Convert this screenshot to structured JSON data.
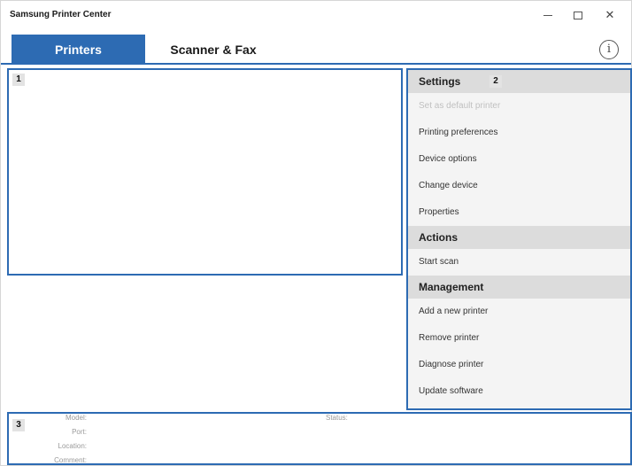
{
  "window": {
    "title": "Samsung Printer Center"
  },
  "tabs": [
    {
      "label": "Printers",
      "active": true
    },
    {
      "label": "Scanner & Fax",
      "active": false
    }
  ],
  "info_icon": "info-circle-icon",
  "panels": {
    "list_number": "1",
    "sidebar_number": "2",
    "details_number": "3"
  },
  "sidebar": {
    "sections": [
      {
        "title": "Settings",
        "items": [
          {
            "label": "Set as default printer",
            "enabled": false
          },
          {
            "label": "Printing preferences",
            "enabled": true
          },
          {
            "label": "Device options",
            "enabled": true
          },
          {
            "label": "Change device",
            "enabled": true
          },
          {
            "label": "Properties",
            "enabled": true
          }
        ]
      },
      {
        "title": "Actions",
        "items": [
          {
            "label": "Start scan",
            "enabled": true
          }
        ]
      },
      {
        "title": "Management",
        "items": [
          {
            "label": "Add a new printer",
            "enabled": true
          },
          {
            "label": "Remove printer",
            "enabled": true
          },
          {
            "label": "Diagnose printer",
            "enabled": true
          },
          {
            "label": "Update software",
            "enabled": true
          }
        ]
      }
    ]
  },
  "details": {
    "model_label": "Model:",
    "port_label": "Port:",
    "location_label": "Location:",
    "comment_label": "Comment:",
    "status_label": "Status:"
  },
  "colors": {
    "accent": "#2d6bb3",
    "section_bg": "#dcdcdc",
    "disabled_text": "#c0c0c0"
  }
}
